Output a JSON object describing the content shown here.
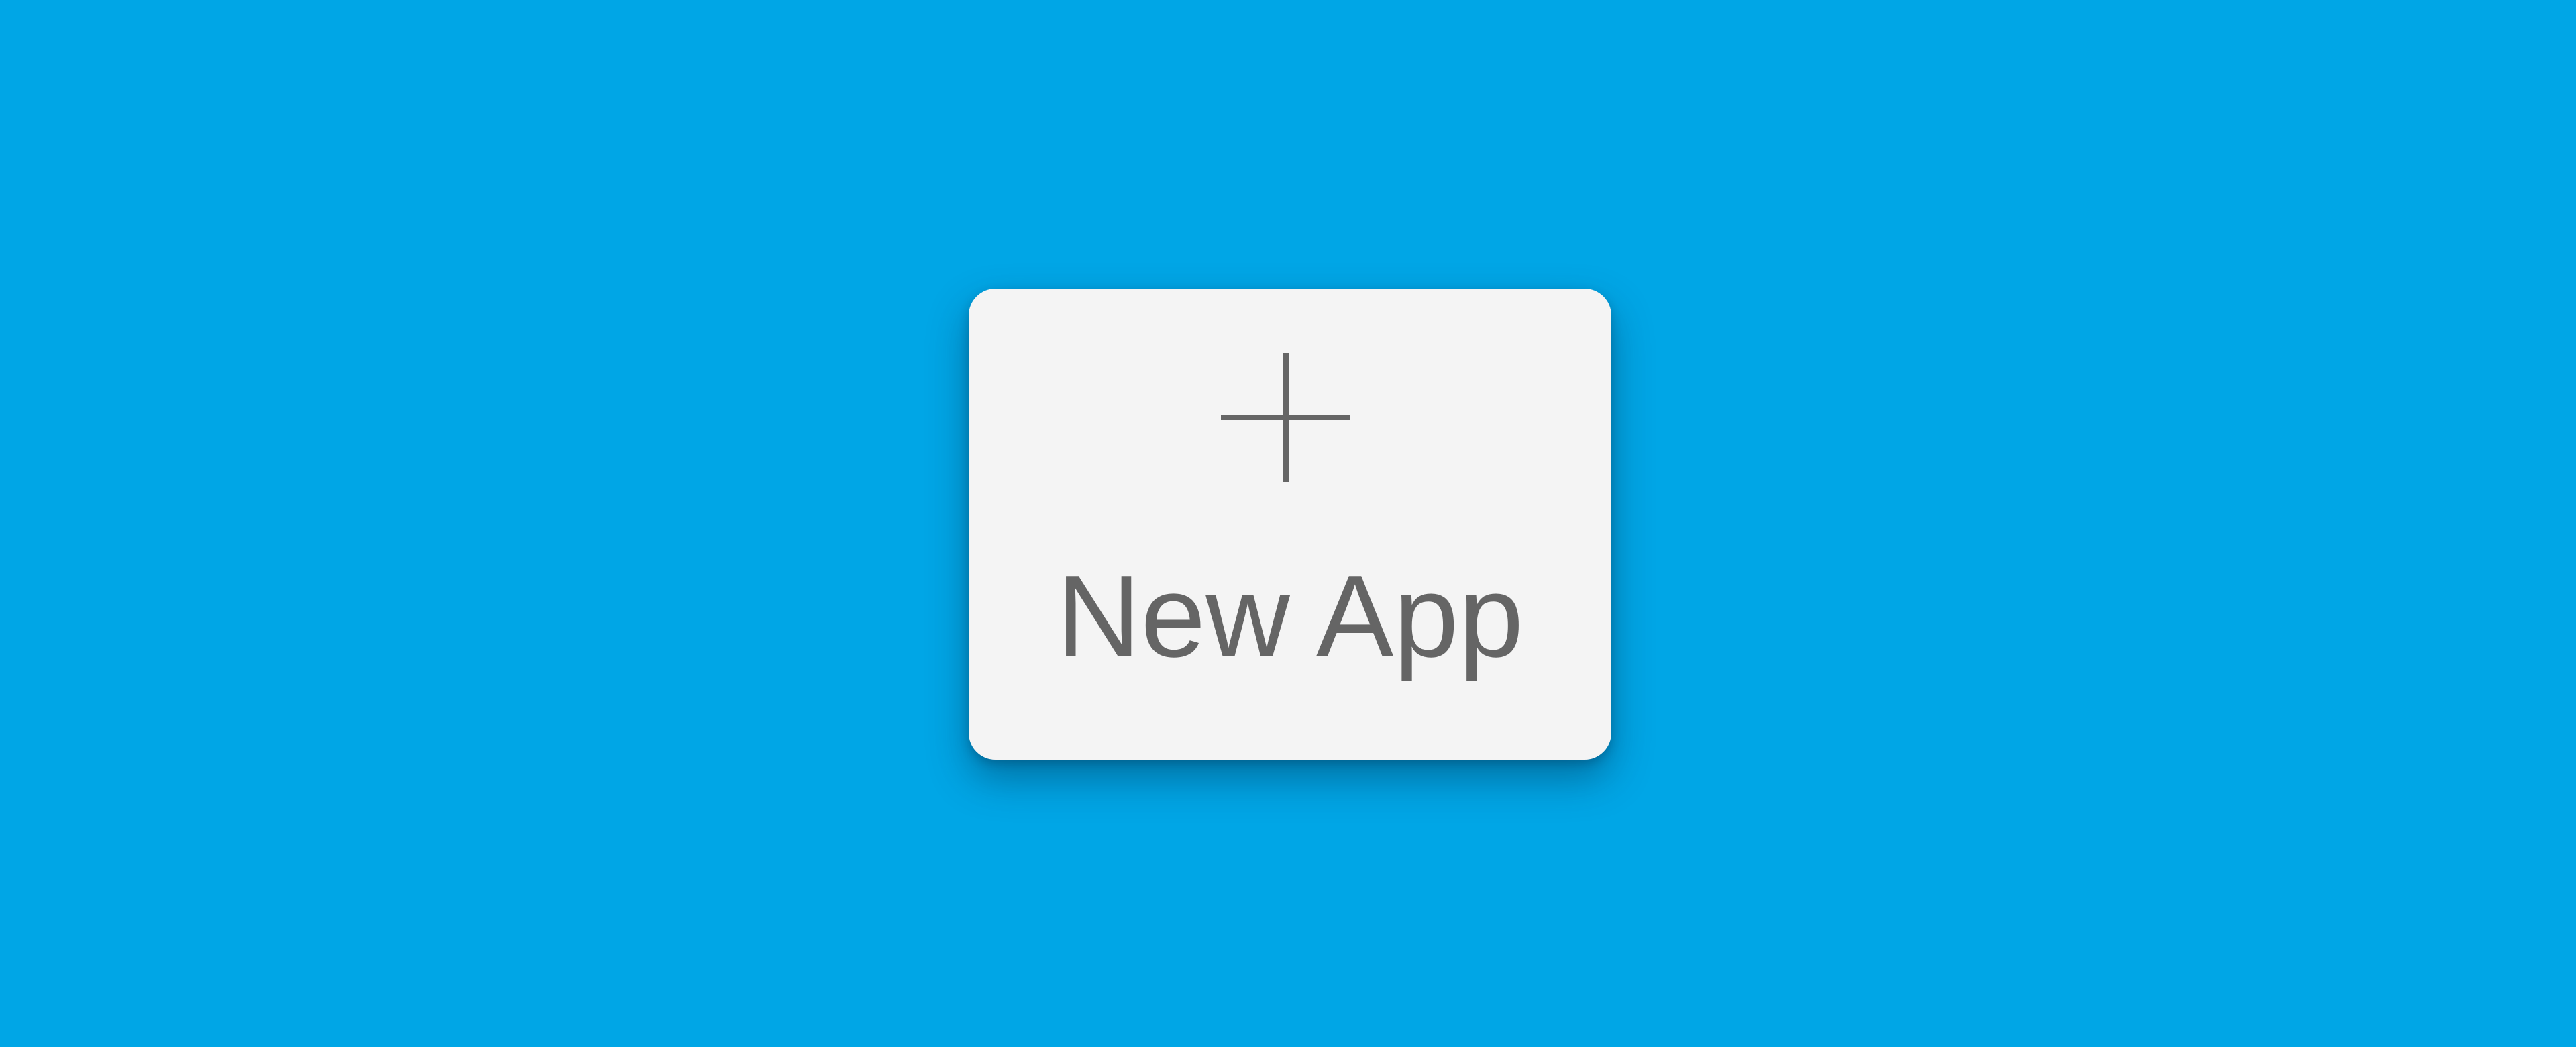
{
  "desktop": {
    "background_colors": {
      "light": "#00a6e6",
      "dark": "#0075aa"
    }
  },
  "new_app_tile": {
    "icon": "plus-icon",
    "label": "New App"
  },
  "colors": {
    "tile_background": "#f4f4f4",
    "tile_foreground": "#656565"
  }
}
